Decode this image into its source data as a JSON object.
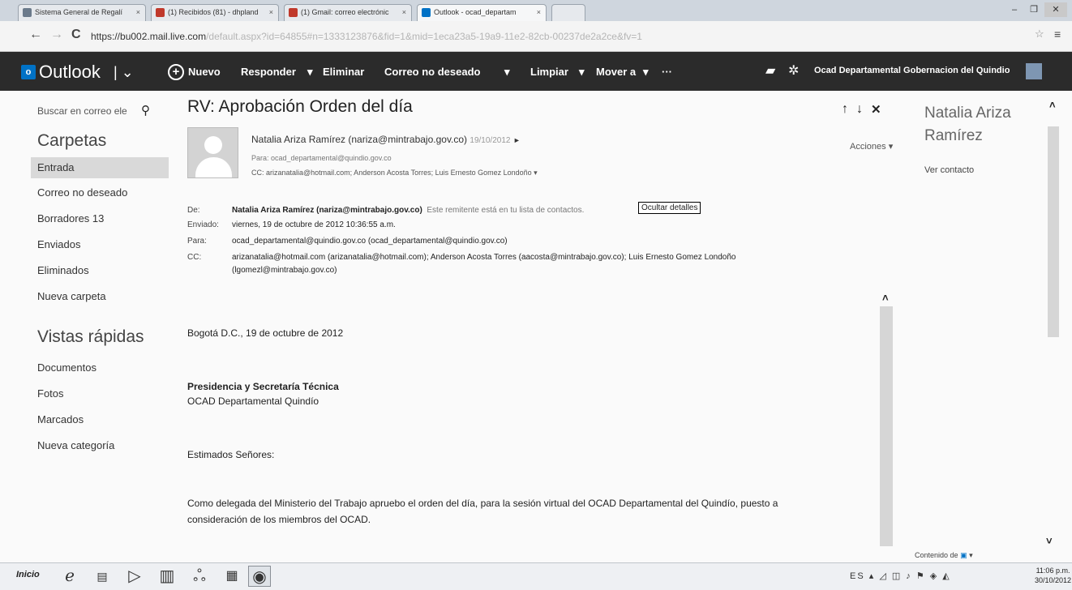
{
  "browser": {
    "tabs": [
      {
        "label": "Sistema General de Regalí"
      },
      {
        "label": "(1) Recibidos (81) - dhpland"
      },
      {
        "label": "(1) Gmail: correo electrónic"
      },
      {
        "label": "Outlook - ocad_departam"
      }
    ],
    "url_host": "https://bu002.mail.live.com",
    "url_rest": "/default.aspx?id=64855#n=1333123876&fid=1&mid=1eca23a5-19a9-11e2-82cb-00237de2a2ce&fv=1"
  },
  "appbar": {
    "brand": "Outlook",
    "commands": {
      "new": "Nuevo",
      "reply": "Responder",
      "delete": "Eliminar",
      "junk": "Correo no deseado",
      "sweep": "Limpiar",
      "move": "Mover a",
      "more": "···"
    },
    "user": "Ocad Departamental Gobernacion del Quindio"
  },
  "nav": {
    "search_placeholder": "Buscar en correo ele",
    "folders_title": "Carpetas",
    "folders": [
      "Entrada",
      "Correo no deseado",
      "Borradores 13",
      "Enviados",
      "Eliminados",
      "Nueva carpeta"
    ],
    "quick_title": "Vistas rápidas",
    "quick_views": [
      "Documentos",
      "Fotos",
      "Marcados",
      "Nueva categoría"
    ]
  },
  "message": {
    "subject": "RV: Aprobación Orden del día",
    "sender_line": "Natalia Ariza Ramírez (nariza@mintrabajo.gov.co)",
    "sent_short": "19/10/2012",
    "to_line": "Para: ocad_departamental@quindio.gov.co",
    "cc_line": "CC: arizanatalia@hotmail.com; Anderson Acosta Torres; Luis Ernesto Gomez Londoño",
    "actions": "Acciones",
    "hide_details": "Ocultar detalles",
    "detail": {
      "from_label": "De:",
      "from_value": "Natalia Ariza Ramírez (nariza@mintrabajo.gov.co)",
      "from_note": "Este remitente está en tu lista de contactos.",
      "sent_label": "Enviado:",
      "sent_value": "viernes, 19 de octubre de 2012 10:36:55 a.m.",
      "to_label": "Para:",
      "to_value": "ocad_departamental@quindio.gov.co (ocad_departamental@quindio.gov.co)",
      "cc_label": "CC:",
      "cc_value_1": "arizanatalia@hotmail.com (arizanatalia@hotmail.com); Anderson Acosta Torres (aacosta@mintrabajo.gov.co); Luis Ernesto Gomez Londoño",
      "cc_value_2": "(lgomezl@mintrabajo.gov.co)"
    },
    "body": {
      "date_line": "Bogotá D.C., 19 de octubre de 2012",
      "org_1": "Presidencia y Secretaría Técnica",
      "org_2": "OCAD Departamental Quindío",
      "greeting": "Estimados Señores:",
      "para_1": "Como delegada del Ministerio del Trabajo apruebo el orden del día, para la sesión virtual del OCAD Departamental del Quindío, puesto a",
      "para_2": "consideración de los miembros del OCAD."
    }
  },
  "contact_pane": {
    "name": "Natalia Ariza Ramírez",
    "view_contact": "Ver contacto",
    "footer": "Contenido de"
  },
  "taskbar": {
    "start": "Inicio",
    "lang": "ES",
    "time": "11:06 p.m.",
    "date": "30/10/2012"
  }
}
